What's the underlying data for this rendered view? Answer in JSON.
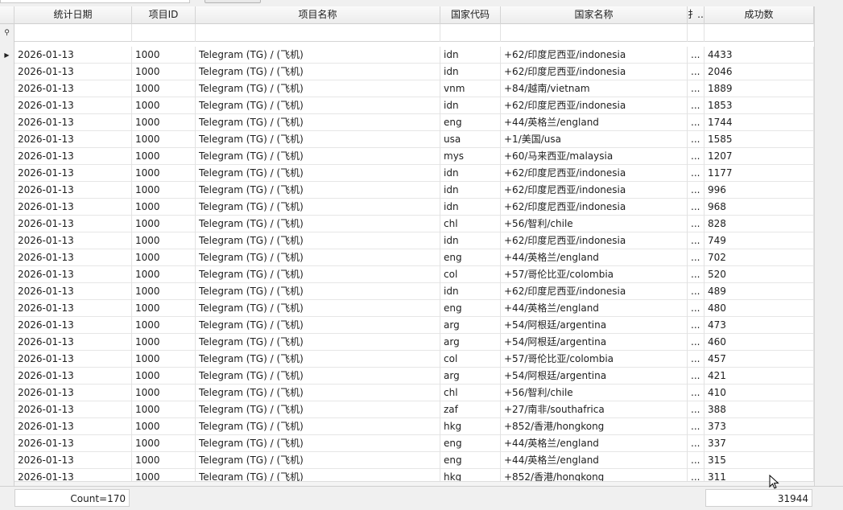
{
  "columns": {
    "date": "统计日期",
    "project_id": "项目ID",
    "project_name": "项目名称",
    "country_code": "国家代码",
    "country_name": "国家名称",
    "truncated": "扌..",
    "success_count": "成功数"
  },
  "rows": [
    {
      "date": "2026-01-13",
      "pid": "1000",
      "name": "Telegram (TG) / (飞机)",
      "code": "idn",
      "cname": "+62/印度尼西亚/indonesia",
      "x": "...",
      "succ": "4433",
      "current": true
    },
    {
      "date": "2026-01-13",
      "pid": "1000",
      "name": "Telegram (TG) / (飞机)",
      "code": "idn",
      "cname": "+62/印度尼西亚/indonesia",
      "x": "...",
      "succ": "2046"
    },
    {
      "date": "2026-01-13",
      "pid": "1000",
      "name": "Telegram (TG) / (飞机)",
      "code": "vnm",
      "cname": "+84/越南/vietnam",
      "x": "...",
      "succ": "1889"
    },
    {
      "date": "2026-01-13",
      "pid": "1000",
      "name": "Telegram (TG) / (飞机)",
      "code": "idn",
      "cname": "+62/印度尼西亚/indonesia",
      "x": "...",
      "succ": "1853"
    },
    {
      "date": "2026-01-13",
      "pid": "1000",
      "name": "Telegram (TG) / (飞机)",
      "code": "eng",
      "cname": "+44/英格兰/england",
      "x": "...",
      "succ": "1744"
    },
    {
      "date": "2026-01-13",
      "pid": "1000",
      "name": "Telegram (TG) / (飞机)",
      "code": "usa",
      "cname": "+1/美国/usa",
      "x": "...",
      "succ": "1585"
    },
    {
      "date": "2026-01-13",
      "pid": "1000",
      "name": "Telegram (TG) / (飞机)",
      "code": "mys",
      "cname": "+60/马来西亚/malaysia",
      "x": "...",
      "succ": "1207"
    },
    {
      "date": "2026-01-13",
      "pid": "1000",
      "name": "Telegram (TG) / (飞机)",
      "code": "idn",
      "cname": "+62/印度尼西亚/indonesia",
      "x": "...",
      "succ": "1177"
    },
    {
      "date": "2026-01-13",
      "pid": "1000",
      "name": "Telegram (TG) / (飞机)",
      "code": "idn",
      "cname": "+62/印度尼西亚/indonesia",
      "x": "...",
      "succ": "996"
    },
    {
      "date": "2026-01-13",
      "pid": "1000",
      "name": "Telegram (TG) / (飞机)",
      "code": "idn",
      "cname": "+62/印度尼西亚/indonesia",
      "x": "...",
      "succ": "968"
    },
    {
      "date": "2026-01-13",
      "pid": "1000",
      "name": "Telegram (TG) / (飞机)",
      "code": "chl",
      "cname": "+56/智利/chile",
      "x": "...",
      "succ": "828"
    },
    {
      "date": "2026-01-13",
      "pid": "1000",
      "name": "Telegram (TG) / (飞机)",
      "code": "idn",
      "cname": "+62/印度尼西亚/indonesia",
      "x": "...",
      "succ": "749"
    },
    {
      "date": "2026-01-13",
      "pid": "1000",
      "name": "Telegram (TG) / (飞机)",
      "code": "eng",
      "cname": "+44/英格兰/england",
      "x": "...",
      "succ": "702"
    },
    {
      "date": "2026-01-13",
      "pid": "1000",
      "name": "Telegram (TG) / (飞机)",
      "code": "col",
      "cname": "+57/哥伦比亚/colombia",
      "x": "...",
      "succ": "520"
    },
    {
      "date": "2026-01-13",
      "pid": "1000",
      "name": "Telegram (TG) / (飞机)",
      "code": "idn",
      "cname": "+62/印度尼西亚/indonesia",
      "x": "...",
      "succ": "489"
    },
    {
      "date": "2026-01-13",
      "pid": "1000",
      "name": "Telegram (TG) / (飞机)",
      "code": "eng",
      "cname": "+44/英格兰/england",
      "x": "...",
      "succ": "480"
    },
    {
      "date": "2026-01-13",
      "pid": "1000",
      "name": "Telegram (TG) / (飞机)",
      "code": "arg",
      "cname": "+54/阿根廷/argentina",
      "x": "...",
      "succ": "473"
    },
    {
      "date": "2026-01-13",
      "pid": "1000",
      "name": "Telegram (TG) / (飞机)",
      "code": "arg",
      "cname": "+54/阿根廷/argentina",
      "x": "...",
      "succ": "460"
    },
    {
      "date": "2026-01-13",
      "pid": "1000",
      "name": "Telegram (TG) / (飞机)",
      "code": "col",
      "cname": "+57/哥伦比亚/colombia",
      "x": "...",
      "succ": "457"
    },
    {
      "date": "2026-01-13",
      "pid": "1000",
      "name": "Telegram (TG) / (飞机)",
      "code": "arg",
      "cname": "+54/阿根廷/argentina",
      "x": "...",
      "succ": "421"
    },
    {
      "date": "2026-01-13",
      "pid": "1000",
      "name": "Telegram (TG) / (飞机)",
      "code": "chl",
      "cname": "+56/智利/chile",
      "x": "...",
      "succ": "410"
    },
    {
      "date": "2026-01-13",
      "pid": "1000",
      "name": "Telegram (TG) / (飞机)",
      "code": "zaf",
      "cname": "+27/南非/southafrica",
      "x": "...",
      "succ": "388"
    },
    {
      "date": "2026-01-13",
      "pid": "1000",
      "name": "Telegram (TG) / (飞机)",
      "code": "hkg",
      "cname": "+852/香港/hongkong",
      "x": "...",
      "succ": "373"
    },
    {
      "date": "2026-01-13",
      "pid": "1000",
      "name": "Telegram (TG) / (飞机)",
      "code": "eng",
      "cname": "+44/英格兰/england",
      "x": "...",
      "succ": "337"
    },
    {
      "date": "2026-01-13",
      "pid": "1000",
      "name": "Telegram (TG) / (飞机)",
      "code": "eng",
      "cname": "+44/英格兰/england",
      "x": "...",
      "succ": "315"
    },
    {
      "date": "2026-01-13",
      "pid": "1000",
      "name": "Telegram (TG) / (飞机)",
      "code": "hkg",
      "cname": "+852/香港/hongkong",
      "x": "...",
      "succ": "311"
    }
  ],
  "footer": {
    "count_label": "Count=170",
    "success_sum": "31944"
  },
  "icons": {
    "current_row": "row-indicator-arrow-icon",
    "filter_row": "filter-icon"
  }
}
